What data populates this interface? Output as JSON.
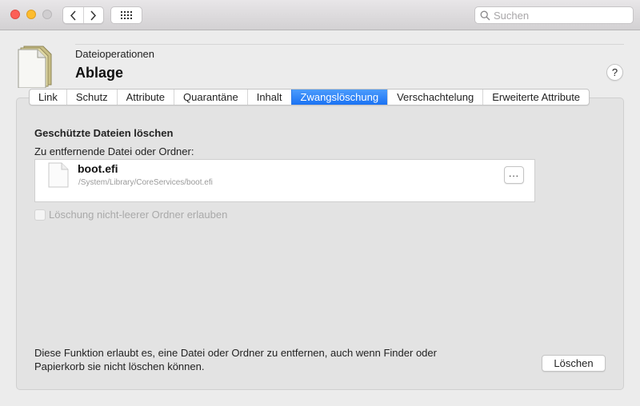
{
  "window": {
    "title_lights": [
      "close",
      "minimize",
      "zoom"
    ],
    "search": {
      "placeholder": "Suchen",
      "value": ""
    }
  },
  "header": {
    "subtitle": "Dateioperationen",
    "title": "Ablage",
    "help_label": "?"
  },
  "tabs": [
    {
      "label": "Link",
      "active": false
    },
    {
      "label": "Schutz",
      "active": false
    },
    {
      "label": "Attribute",
      "active": false
    },
    {
      "label": "Quarantäne",
      "active": false
    },
    {
      "label": "Inhalt",
      "active": false
    },
    {
      "label": "Zwangslöschung",
      "active": true
    },
    {
      "label": "Verschachtelung",
      "active": false
    },
    {
      "label": "Erweiterte Attribute",
      "active": false
    }
  ],
  "main": {
    "section_heading": "Geschützte Dateien löschen",
    "field_label": "Zu entfernende Datei oder Ordner:",
    "file": {
      "name": "boot.efi",
      "path": "/System/Library/CoreServices/boot.efi",
      "more_label": "..."
    },
    "checkbox": {
      "label": "Löschung nicht-leerer Ordner erlauben",
      "checked": false,
      "enabled": false
    },
    "footer_text": "Diese Funktion erlaubt es, eine Datei oder Ordner zu entfernen, auch wenn Finder oder Papierkorb sie nicht löschen können.",
    "delete_label": "Löschen"
  },
  "colors": {
    "accent": "#1a72f3",
    "close": "#fc5f57",
    "minimize": "#fdbc2e"
  }
}
